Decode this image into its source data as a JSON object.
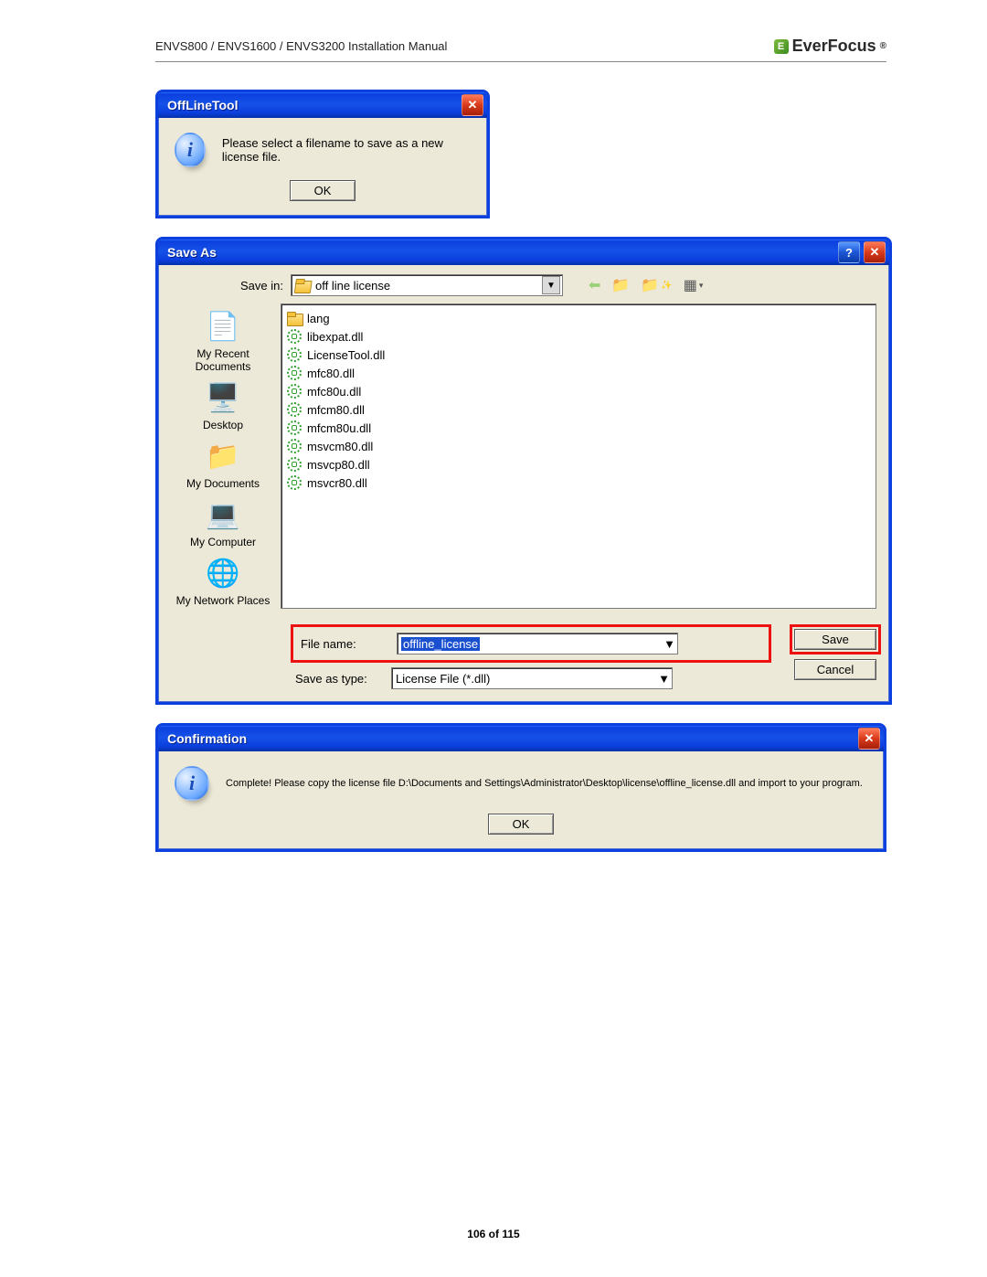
{
  "doc": {
    "header_title": "ENVS800 / ENVS1600 / ENVS3200 Installation Manual",
    "brand": "EverFocus",
    "page_num": "106",
    "page_total": "115",
    "page_of": "of"
  },
  "dialog1": {
    "title": "OffLineTool",
    "message": "Please select a filename to save as a new license file.",
    "ok_label": "OK"
  },
  "saveas": {
    "title": "Save As",
    "save_in_label": "Save in:",
    "save_in_value": "off line license",
    "places": [
      {
        "label": "My Recent Documents"
      },
      {
        "label": "Desktop"
      },
      {
        "label": "My Documents"
      },
      {
        "label": "My Computer"
      },
      {
        "label": "My Network Places"
      }
    ],
    "files": [
      {
        "type": "folder",
        "name": "lang"
      },
      {
        "type": "dll",
        "name": "libexpat.dll"
      },
      {
        "type": "dll",
        "name": "LicenseTool.dll"
      },
      {
        "type": "dll",
        "name": "mfc80.dll"
      },
      {
        "type": "dll",
        "name": "mfc80u.dll"
      },
      {
        "type": "dll",
        "name": "mfcm80.dll"
      },
      {
        "type": "dll",
        "name": "mfcm80u.dll"
      },
      {
        "type": "dll",
        "name": "msvcm80.dll"
      },
      {
        "type": "dll",
        "name": "msvcp80.dll"
      },
      {
        "type": "dll",
        "name": "msvcr80.dll"
      }
    ],
    "filename_label": "File name:",
    "filename_value": "offline_license",
    "type_label": "Save as type:",
    "type_value": "License File (*.dll)",
    "save_btn": "Save",
    "cancel_btn": "Cancel"
  },
  "dialog2": {
    "title": "Confirmation",
    "message": "Complete! Please copy the license file D:\\Documents and Settings\\Administrator\\Desktop\\license\\offline_license.dll and import to your program.",
    "ok_label": "OK"
  }
}
